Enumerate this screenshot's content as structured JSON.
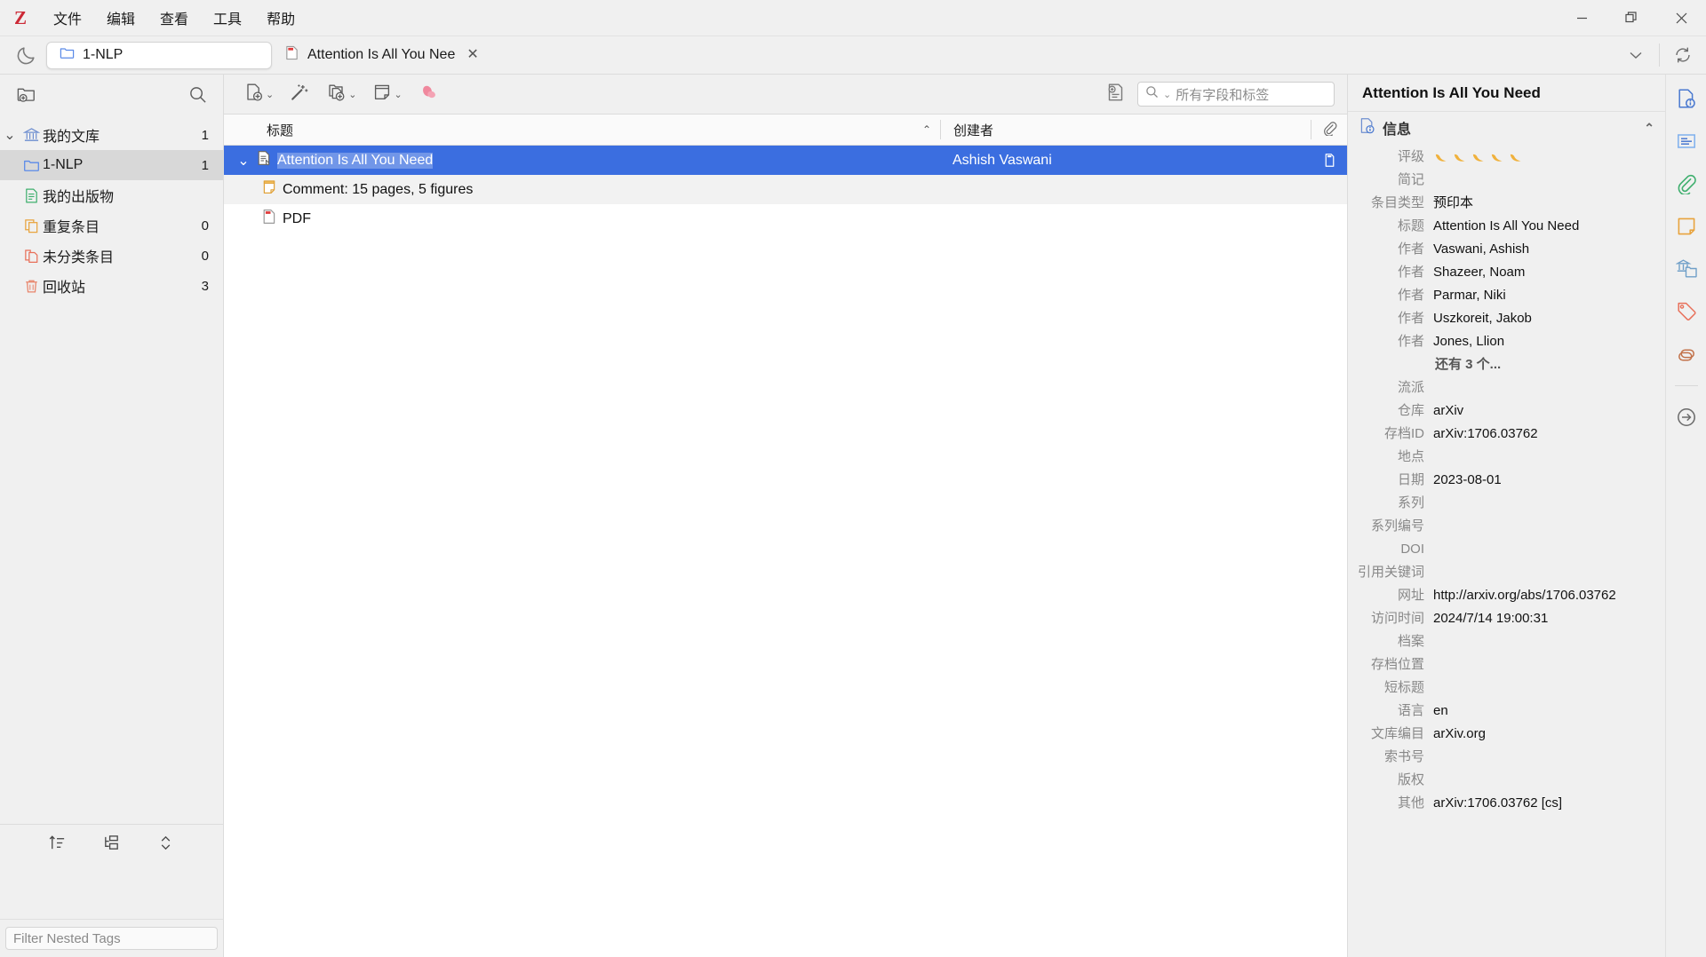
{
  "app": {
    "logo_letter": "Z",
    "menus": [
      "文件",
      "编辑",
      "查看",
      "工具",
      "帮助"
    ],
    "window_controls": {
      "minimize": "—",
      "maximize": "❐",
      "close": "✕"
    }
  },
  "tabbar": {
    "library_tab": "1-NLP",
    "item_tab": "Attention Is All You Nee",
    "item_tab_close": "✕",
    "list_all_tabs_icon": "chevron-down-icon",
    "sync_icon": "sync-icon",
    "appearance_icon": "moon-icon"
  },
  "sidebar": {
    "new_collection_icon": "new-collection-icon",
    "search_icon": "search-icon",
    "items": [
      {
        "label": "我的文库",
        "count": "1",
        "icon": "library-icon",
        "indent": 0,
        "twisty": "⌄",
        "selected": false
      },
      {
        "label": "1-NLP",
        "count": "1",
        "icon": "folder-icon",
        "indent": 1,
        "twisty": "",
        "selected": true
      },
      {
        "label": "我的出版物",
        "count": "",
        "icon": "publications-icon",
        "indent": 1,
        "twisty": "",
        "selected": false
      },
      {
        "label": "重复条目",
        "count": "0",
        "icon": "duplicates-icon",
        "indent": 1,
        "twisty": "",
        "selected": false
      },
      {
        "label": "未分类条目",
        "count": "0",
        "icon": "unfiled-icon",
        "indent": 1,
        "twisty": "",
        "selected": false
      },
      {
        "label": "回收站",
        "count": "3",
        "icon": "trash-icon",
        "indent": 1,
        "twisty": "",
        "selected": false
      }
    ],
    "tag_toolbar": [
      "tag-sort-icon",
      "tag-nested-icon",
      "tag-expand-icon"
    ],
    "tag_filter_placeholder": "Filter Nested Tags"
  },
  "items_toolbar": {
    "new_item_label": "new-item-icon",
    "magic_wand_label": "add-by-identifier-icon",
    "add_attachment_label": "add-attachment-icon",
    "new_note_label": "new-note-icon",
    "plugin_label": "plugin-icon",
    "advanced_search_label": "advanced-search-icon",
    "search_placeholder": "所有字段和标签"
  },
  "items_table": {
    "columns": {
      "title": "标题",
      "creator": "创建者",
      "attachment": "attachment-icon"
    },
    "sort_indicator": "⌃",
    "rows": [
      {
        "title": "Attention Is All You Need",
        "creator": "Ashish Vaswani",
        "icon": "preprint-icon",
        "twisty": "⌄",
        "level": 0,
        "selected": true,
        "attachment": "attachment-badge-icon"
      },
      {
        "title": "Comment: 15 pages, 5 figures",
        "creator": "",
        "icon": "note-icon",
        "twisty": "",
        "level": 1,
        "selected": false,
        "attachment": ""
      },
      {
        "title": "PDF",
        "creator": "",
        "icon": "pdf-icon",
        "twisty": "",
        "level": 1,
        "selected": false,
        "attachment": ""
      }
    ]
  },
  "item_pane": {
    "title": "Attention Is All You Need",
    "section": {
      "label": "信息",
      "icon": "info-icon",
      "collapse": "⌃"
    },
    "rating_label": "评级",
    "rating_count": 5,
    "fields": [
      {
        "label": "简记",
        "value": ""
      },
      {
        "label": "条目类型",
        "value": "预印本"
      },
      {
        "label": "标题",
        "value": "Attention Is All You Need"
      },
      {
        "label": "作者",
        "value": "Vaswani, Ashish"
      },
      {
        "label": "作者",
        "value": "Shazeer, Noam"
      },
      {
        "label": "作者",
        "value": "Parmar, Niki"
      },
      {
        "label": "作者",
        "value": "Uszkoreit, Jakob"
      },
      {
        "label": "作者",
        "value": "Jones, Llion"
      },
      {
        "label": "",
        "value": "还有 3 个...",
        "more": true
      },
      {
        "label": "流派",
        "value": ""
      },
      {
        "label": "仓库",
        "value": "arXiv"
      },
      {
        "label": "存档ID",
        "value": "arXiv:1706.03762"
      },
      {
        "label": "地点",
        "value": ""
      },
      {
        "label": "日期",
        "value": "2023-08-01"
      },
      {
        "label": "系列",
        "value": ""
      },
      {
        "label": "系列编号",
        "value": ""
      },
      {
        "label": "DOI",
        "value": ""
      },
      {
        "label": "引用关键词",
        "value": ""
      },
      {
        "label": "网址",
        "value": "http://arxiv.org/abs/1706.03762"
      },
      {
        "label": "访问时间",
        "value": "2024/7/14 19:00:31"
      },
      {
        "label": "档案",
        "value": ""
      },
      {
        "label": "存档位置",
        "value": ""
      },
      {
        "label": "短标题",
        "value": ""
      },
      {
        "label": "语言",
        "value": "en"
      },
      {
        "label": "文库编目",
        "value": "arXiv.org"
      },
      {
        "label": "索书号",
        "value": ""
      },
      {
        "label": "版权",
        "value": ""
      },
      {
        "label": "其他",
        "value": "arXiv:1706.03762 [cs]"
      }
    ],
    "strip_icons": [
      "info-pane-icon",
      "abstract-pane-icon",
      "attachments-pane-icon",
      "notes-pane-icon",
      "libraries-collections-pane-icon",
      "tags-pane-icon",
      "related-pane-icon",
      "locate-pane-icon"
    ]
  },
  "colors": {
    "accent": "#3b6ee0",
    "logo_red": "#cc2936",
    "folder_blue": "#5b8ae8",
    "green": "#3faf6e",
    "orange": "#e8a33d",
    "red_orange": "#e8705a",
    "pink": "#f28ba0"
  }
}
